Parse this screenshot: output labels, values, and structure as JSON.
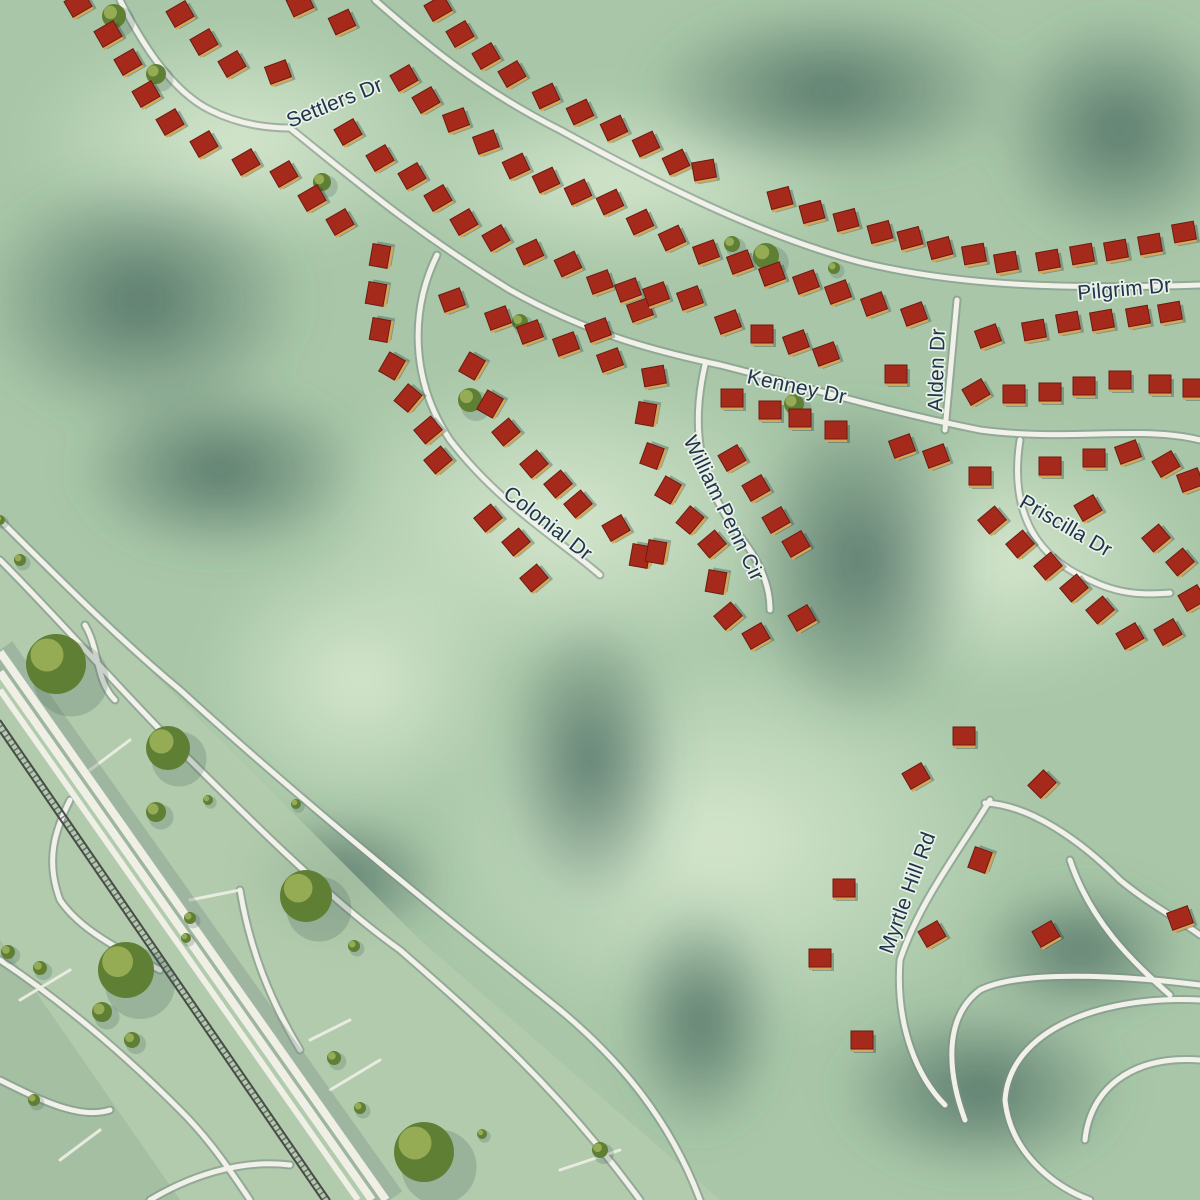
{
  "map": {
    "colors": {
      "terrain_light": "#cfe2c7",
      "terrain_mid": "#a9c7a8",
      "terrain_dark": "#6f9487",
      "shadow": "#3e5f57",
      "flat_land": "#bcd3b6",
      "road": "#f1f1ea",
      "road_edge": "#7c8f86",
      "rail": "#4a4a4a",
      "roof": "#a52a1c",
      "roof_edge": "#6e1a10",
      "wall": "#d6a55a",
      "tree": "#5f7f34",
      "label_text": "#22344d"
    },
    "streets": [
      {
        "id": "settlers-dr",
        "name": "Settlers Dr"
      },
      {
        "id": "pilgrim-dr",
        "name": "Pilgrim Dr"
      },
      {
        "id": "alden-dr",
        "name": "Alden Dr"
      },
      {
        "id": "kenney-dr",
        "name": "Kenney Dr"
      },
      {
        "id": "colonial-dr",
        "name": "Colonial Dr"
      },
      {
        "id": "william-penn-cir",
        "name": "William Penn Cir"
      },
      {
        "id": "priscilla-dr",
        "name": "Priscilla Dr"
      },
      {
        "id": "myrtle-hill-rd",
        "name": "Myrtle Hill Rd"
      }
    ]
  }
}
